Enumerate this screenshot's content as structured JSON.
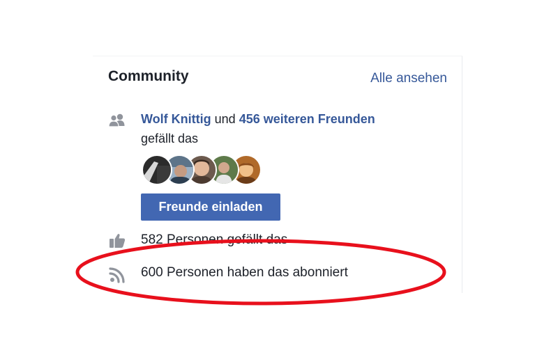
{
  "community": {
    "title": "Community",
    "see_all_label": "Alle ansehen",
    "friends": {
      "first_friend": "Wolf Knittig",
      "connector": "und",
      "others_link": "456 weiteren Freunden",
      "suffix": "gefällt das",
      "icon": "friends-icon",
      "avatars": [
        "friend-avatar-1",
        "friend-avatar-2",
        "friend-avatar-3",
        "friend-avatar-4",
        "friend-avatar-5"
      ]
    },
    "invite_button_label": "Freunde einladen",
    "likes": {
      "icon": "thumbs-up-icon",
      "text": "582 Personen gefällt das"
    },
    "followers": {
      "icon": "rss-icon",
      "text": "600 Personen haben das abonniert"
    }
  },
  "colors": {
    "link": "#365899",
    "button": "#4267b2",
    "icon_gray": "#90949c",
    "annotation_red": "#e8101c"
  }
}
